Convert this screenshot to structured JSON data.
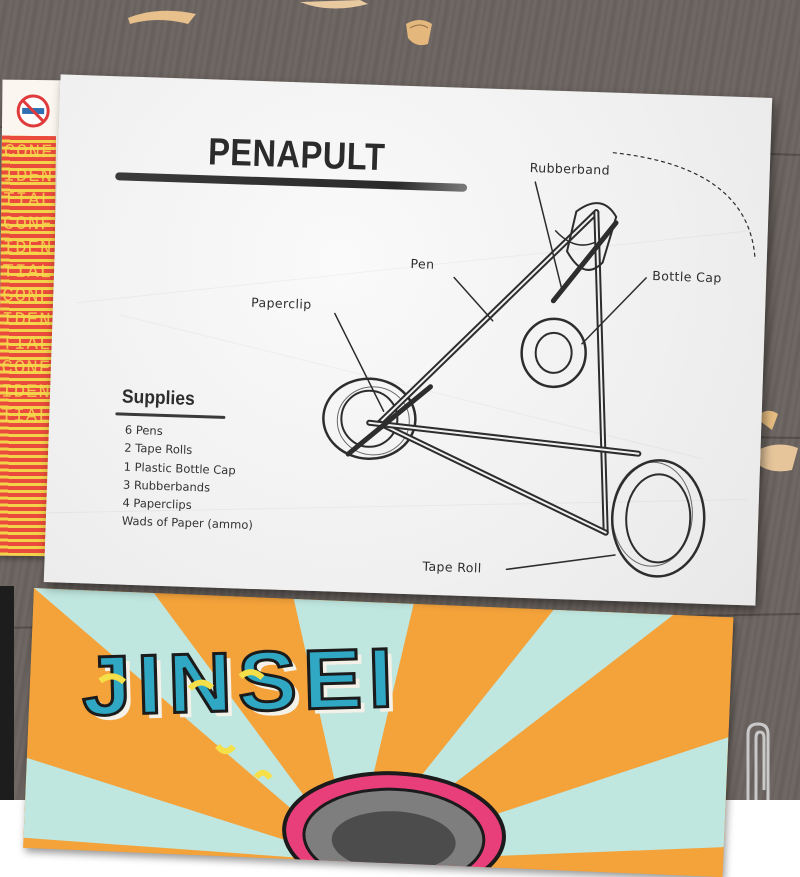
{
  "card": {
    "title": "PENAPULT",
    "supplies": {
      "heading": "Supplies",
      "items": [
        "6 Pens",
        "2 Tape Rolls",
        "1 Plastic Bottle Cap",
        "3 Rubberbands",
        "4 Paperclips",
        "Wads of Paper (ammo)"
      ]
    },
    "labels": {
      "rubberband": "Rubberband",
      "pen": "Pen",
      "bottle_cap": "Bottle Cap",
      "paperclip": "Paperclip",
      "tape_roll": "Tape Roll"
    }
  },
  "bottom_poster": {
    "title": "JINSEI"
  },
  "left_poster": {
    "pattern_text": "CONFIDENTIALCONFIDENTIALCONFIDENTIALCONFIDENTIAL"
  },
  "colors": {
    "wood": "#6d6662",
    "card_paper": "#f2f2f2",
    "ink": "#2b2b2b",
    "poster_orange": "#f4a23a",
    "poster_blue": "#30a8c4",
    "poster_mint": "#bfe6df",
    "left_poster_red": "#ea4b3c",
    "left_poster_yellow": "#f3d34a"
  }
}
